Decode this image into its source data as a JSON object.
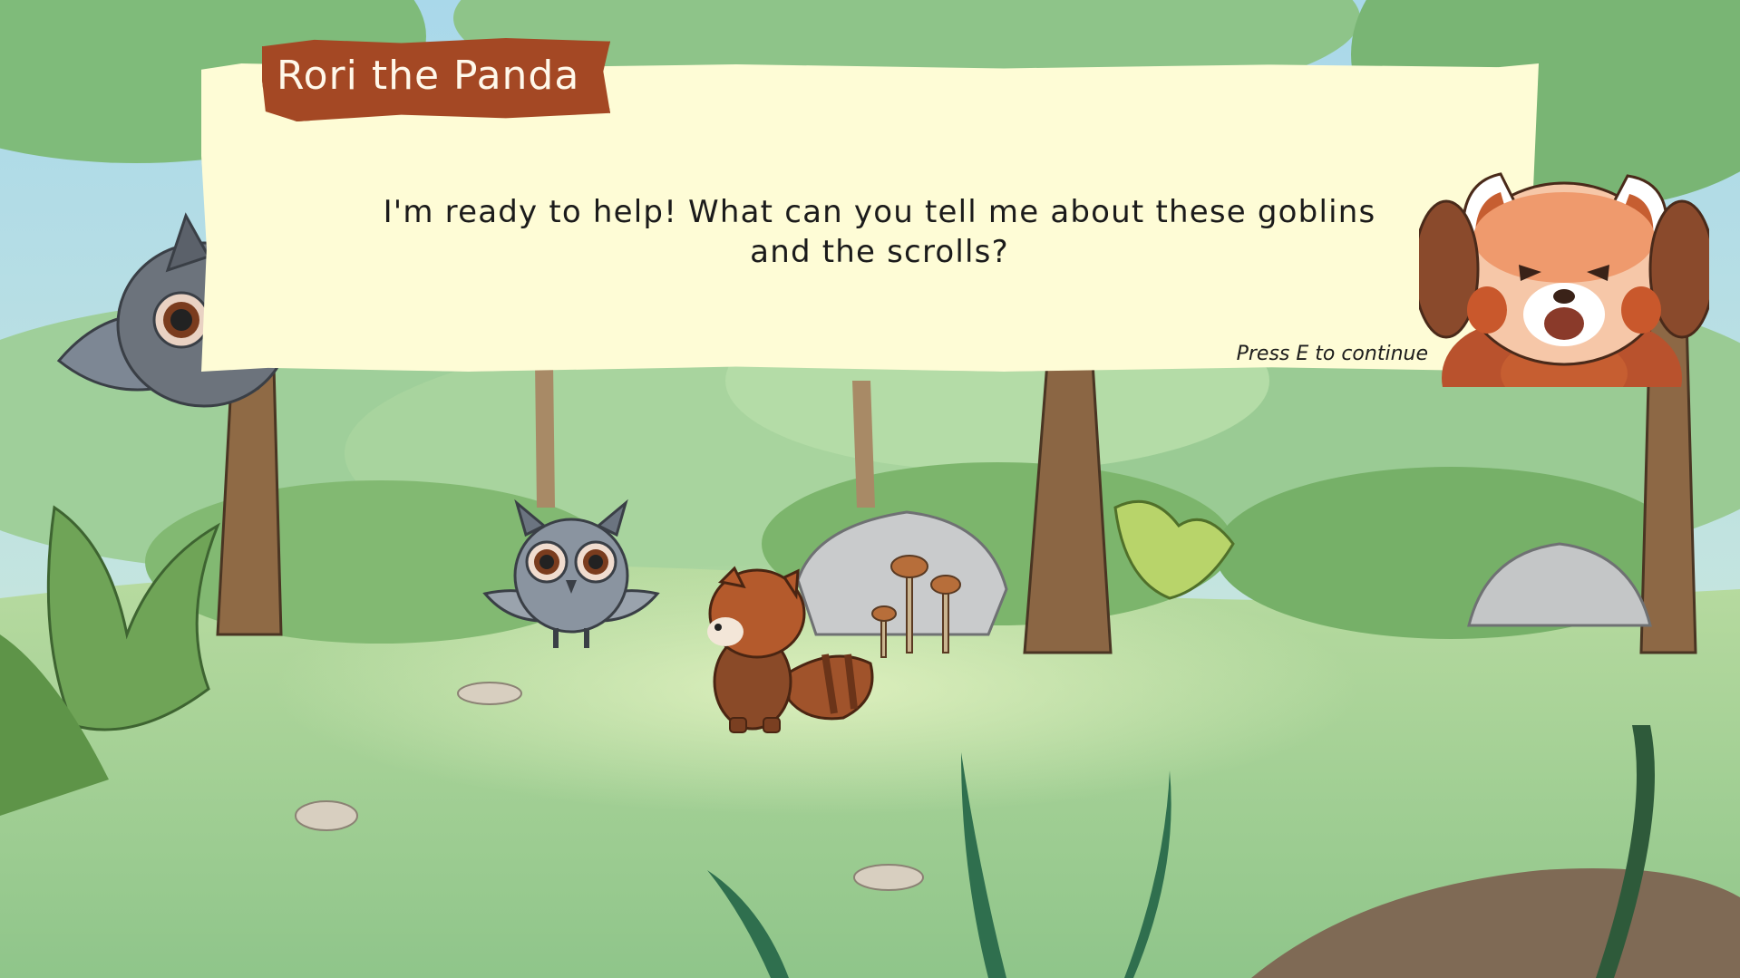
{
  "dialog": {
    "speaker_name": "Rori the Panda",
    "message": "I'm ready to help! What can you tell me about these goblins and the scrolls?",
    "continue_hint": "Press E to continue"
  },
  "colors": {
    "dialog_bg": "#fefcd6",
    "name_plate": "#a44824",
    "name_text": "#fff8ea"
  },
  "icons": {
    "portrait": "red-panda-portrait-icon",
    "owl_flying": "owl-flying-icon",
    "owl_standing": "owl-icon",
    "player": "red-panda-icon"
  }
}
